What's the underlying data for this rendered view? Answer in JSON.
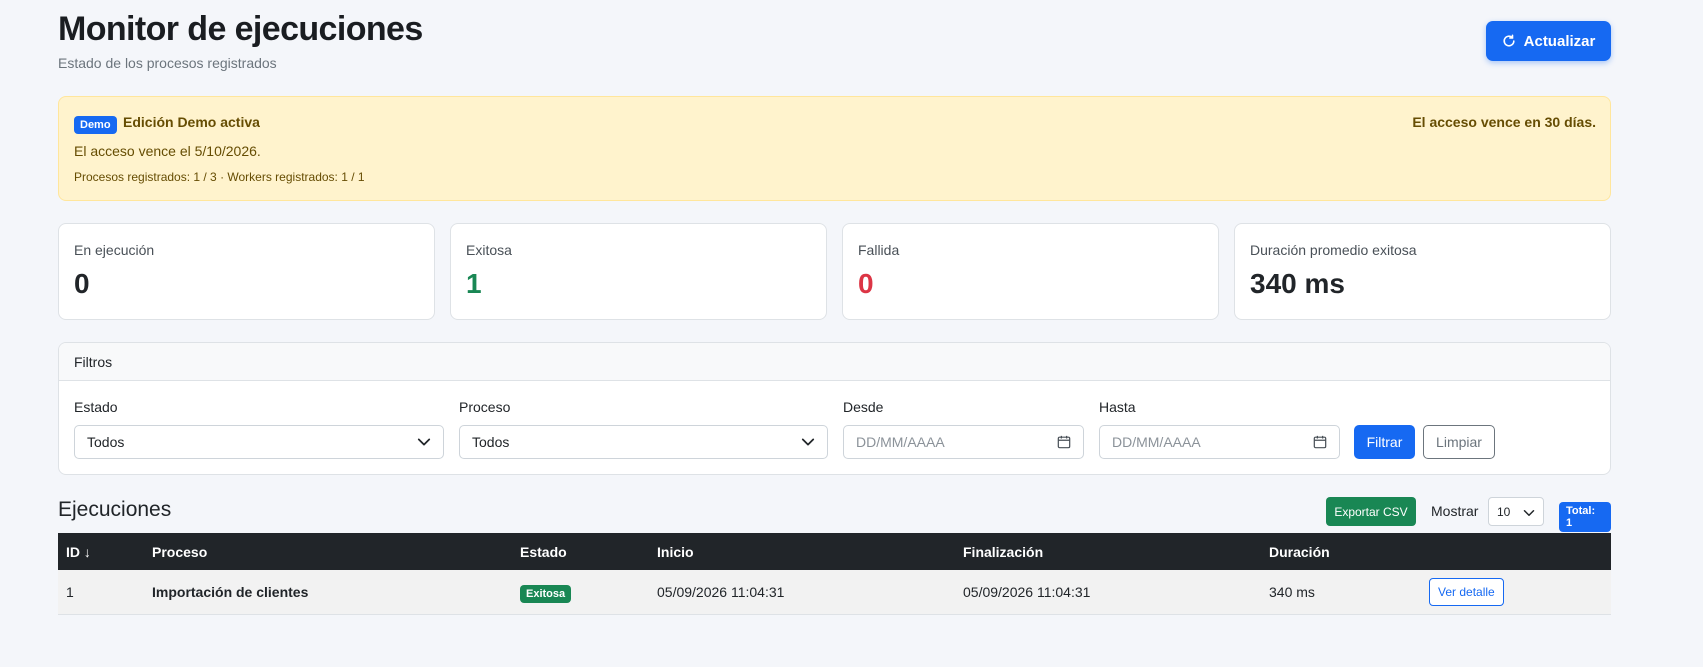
{
  "header": {
    "title": "Monitor de ejecuciones",
    "subtitle": "Estado de los procesos registrados",
    "refresh_label": "Actualizar"
  },
  "alert": {
    "badge": "Demo",
    "title": "Edición Demo activa",
    "expires_in": "El acceso vence en 30 días.",
    "expires_on": "El acceso vence el 5/10/2026.",
    "usage": "Procesos registrados: 1 / 3 · Workers registrados: 1 / 1"
  },
  "stats": [
    {
      "label": "En ejecución",
      "value": "0"
    },
    {
      "label": "Exitosa",
      "value": "1"
    },
    {
      "label": "Fallida",
      "value": "0"
    },
    {
      "label": "Duración promedio exitosa",
      "value": "340 ms"
    }
  ],
  "filters": {
    "heading": "Filtros",
    "estado": {
      "label": "Estado",
      "value": "Todos"
    },
    "proceso": {
      "label": "Proceso",
      "value": "Todos"
    },
    "desde": {
      "label": "Desde",
      "placeholder": "DD/MM/AAAA"
    },
    "hasta": {
      "label": "Hasta",
      "placeholder": "DD/MM/AAAA"
    },
    "filter_label": "Filtrar",
    "clear_label": "Limpiar"
  },
  "executions": {
    "title": "Ejecuciones",
    "export_label": "Exportar CSV",
    "show_label": "Mostrar",
    "page_size": "10",
    "total": "Total: 1",
    "columns": [
      "ID ↓",
      "Proceso",
      "Estado",
      "Inicio",
      "Finalización",
      "Duración"
    ],
    "rows": [
      {
        "id": "1",
        "process": "Importación de clientes",
        "status": "Exitosa",
        "start": "05/09/2026 11:04:31",
        "end": "05/09/2026 11:04:31",
        "duration": "340 ms",
        "action": "Ver detalle"
      }
    ]
  },
  "colors": {
    "primary": "#1669f2",
    "success": "#198754",
    "danger": "#dc3545",
    "warning_bg": "#fff3cd",
    "table_head": "#212529"
  }
}
